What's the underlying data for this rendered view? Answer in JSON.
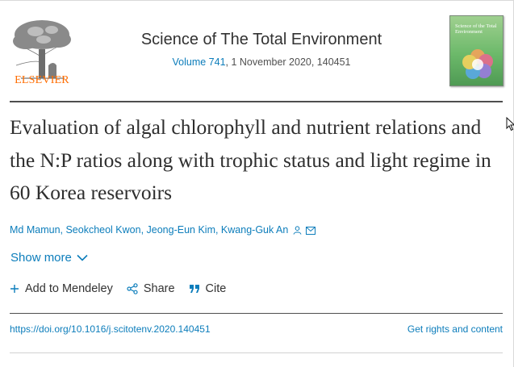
{
  "publisher": {
    "name": "ELSEVIER",
    "logo_icon": "elsevier-tree-logo-icon"
  },
  "journal": {
    "title": "Science of The Total Environment",
    "volume_link": "Volume 741",
    "issue_rest": ", 1 November 2020, 140451",
    "cover_title": "Science of the Total Environment"
  },
  "article": {
    "title": "Evaluation of algal chlorophyll and nutrient relations and the N:P ratios along with trophic status and light regime in 60 Korea reservoirs",
    "authors": "Md Mamun, Seokcheol Kwon, Jeong-Eun Kim, Kwang-Guk An",
    "show_more": "Show more"
  },
  "actions": {
    "mendeley": "Add to Mendeley",
    "share": "Share",
    "cite": "Cite"
  },
  "links": {
    "doi": "https://doi.org/10.1016/j.scitotenv.2020.140451",
    "rights": "Get rights and content"
  },
  "colors": {
    "link": "#0c7dbb",
    "brand": "#ff6c00",
    "text": "#2e2e2e"
  }
}
